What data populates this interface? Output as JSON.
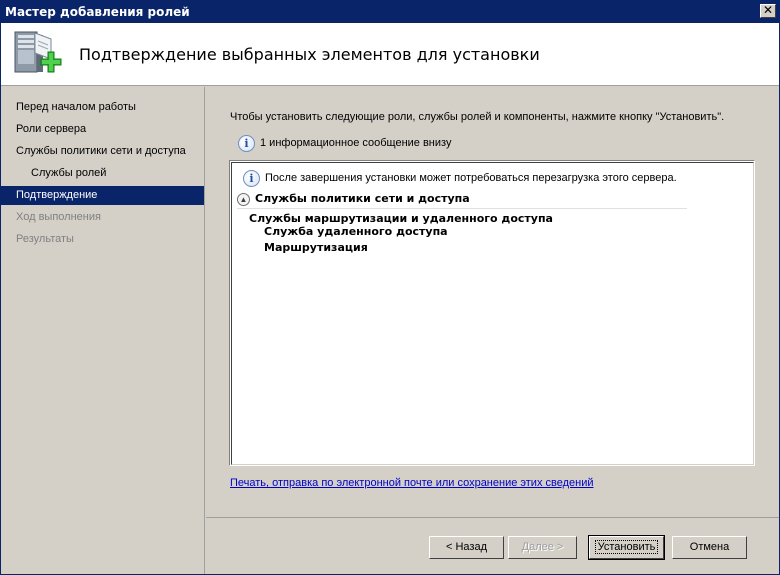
{
  "window": {
    "title": "Мастер добавления ролей",
    "close_glyph": "✕"
  },
  "header": {
    "title": "Подтверждение выбранных элементов для установки",
    "icon": "server-add-icon"
  },
  "sidebar": {
    "items": [
      {
        "label": "Перед началом работы",
        "state": "normal"
      },
      {
        "label": "Роли сервера",
        "state": "normal"
      },
      {
        "label": "Службы политики сети и доступа",
        "state": "normal"
      },
      {
        "label": "Службы ролей",
        "state": "normal"
      },
      {
        "label": "Подтверждение",
        "state": "active"
      },
      {
        "label": "Ход выполнения",
        "state": "disabled"
      },
      {
        "label": "Результаты",
        "state": "disabled"
      }
    ]
  },
  "main": {
    "intro": "Чтобы установить следующие роли, службы ролей и компоненты, нажмите кнопку \"Установить\".",
    "info_count": "1 информационное сообщение внизу",
    "warning": "После завершения установки может потребоваться перезагрузка этого сервера.",
    "section_title": "Службы политики сети и доступа",
    "collapse_glyph": "▲",
    "roles": [
      "Службы маршрутизации и удаленного доступа",
      "Служба удаленного доступа",
      "Маршрутизация"
    ],
    "link": "Печать, отправка по электронной почте или сохранение этих сведений"
  },
  "buttons": {
    "back": "< Назад",
    "next": "Далее >",
    "install": "Установить",
    "cancel": "Отмена"
  },
  "colors": {
    "titlebar": "#0a246a",
    "selected": "#0a246a",
    "link": "#0000cc"
  }
}
